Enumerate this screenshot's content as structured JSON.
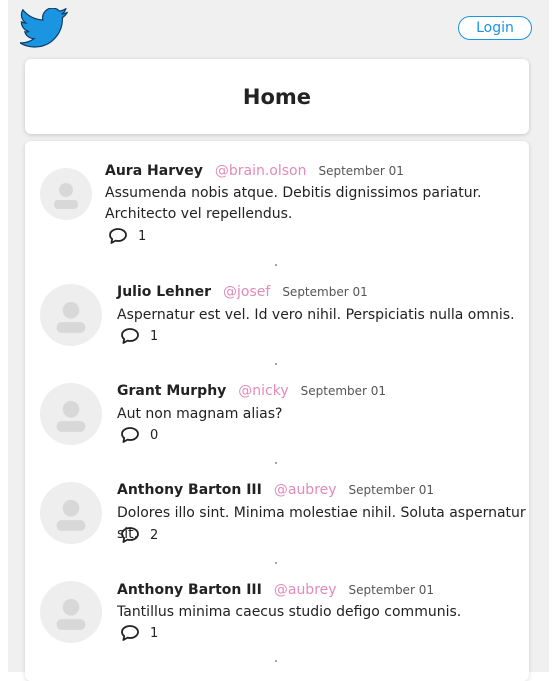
{
  "header": {
    "login_label": "Login",
    "title": "Home"
  },
  "colors": {
    "brand": "#1b95e0",
    "handle": "#e48ab9"
  },
  "tweets": [
    {
      "name": "Aura Harvey",
      "handle": "@brain.olson",
      "date": "September 01",
      "text": "Assumenda nobis atque. Debitis dignissimos pariatur. Architecto vel repellendus.",
      "replies": "1"
    },
    {
      "name": "Julio Lehner",
      "handle": "@josef",
      "date": "September 01",
      "text": "Aspernatur est vel. Id vero nihil. Perspiciatis nulla omnis.",
      "replies": "1"
    },
    {
      "name": "Grant Murphy",
      "handle": "@nicky",
      "date": "September 01",
      "text": "Aut non magnam alias?",
      "replies": "0"
    },
    {
      "name": "Anthony Barton III",
      "handle": "@aubrey",
      "date": "September 01",
      "text": "Dolores illo sint. Minima molestiae nihil. Soluta aspernatur sit.",
      "replies": "2"
    },
    {
      "name": "Anthony Barton III",
      "handle": "@aubrey",
      "date": "September 01",
      "text": "Tantillus minima caecus studio defigo communis.",
      "replies": "1"
    }
  ]
}
